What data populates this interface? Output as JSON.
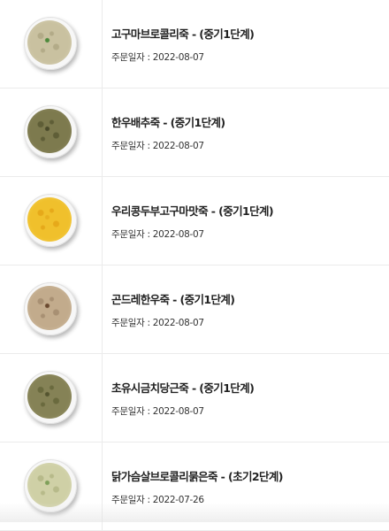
{
  "orders": [
    {
      "name": "고구마브로콜리죽 - (중기1단계)",
      "date_label": "주문일자 : 2022-08-07",
      "colors": {
        "base": "#c9c1a0",
        "spot": "#b3ab88",
        "rim": "#d8d2b6",
        "accent": "#4e8a3c"
      }
    },
    {
      "name": "한우배추죽 - (중기1단계)",
      "date_label": "주문일자 : 2022-08-07",
      "colors": {
        "base": "#7d7a4e",
        "spot": "#5f5e37",
        "rim": "#8f8a60",
        "accent": "#4a4a2a"
      }
    },
    {
      "name": "우리콩두부고구마맛죽 - (중기1단계)",
      "date_label": "주문일자 : 2022-08-07",
      "colors": {
        "base": "#f0c02c",
        "spot": "#e6a91a",
        "rim": "#f5d150",
        "accent": "#e8b020"
      }
    },
    {
      "name": "곤드레한우죽 - (중기1단계)",
      "date_label": "주문일자 : 2022-08-07",
      "colors": {
        "base": "#c2ab8c",
        "spot": "#a89073",
        "rim": "#d4c2a7",
        "accent": "#6b4a30"
      }
    },
    {
      "name": "초유시금치당근죽 - (중기1단계)",
      "date_label": "주문일자 : 2022-08-07",
      "colors": {
        "base": "#858256",
        "spot": "#6a6a3e",
        "rim": "#9a9468",
        "accent": "#555530"
      }
    },
    {
      "name": "닭가슴살브로콜리묽은죽 - (초기2단계)",
      "date_label": "주문일자 : 2022-07-26",
      "colors": {
        "base": "#cfd0a6",
        "spot": "#b7ba8a",
        "rim": "#dddcbc",
        "accent": "#7fa05a"
      }
    }
  ]
}
